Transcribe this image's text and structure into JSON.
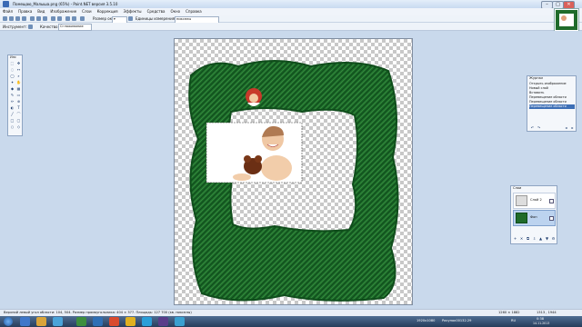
{
  "window": {
    "title": "Помещаю_Малыша.png (65%) - Paint.NET версия 3.5.10",
    "min": "–",
    "max": "□",
    "close": "✕"
  },
  "menu": [
    "Файл",
    "Правка",
    "Вид",
    "Изображение",
    "Слои",
    "Коррекция",
    "Эффекты",
    "Средства",
    "Окно",
    "Справка"
  ],
  "toolbar": {
    "size_label": "Размер окна",
    "units_label": "Единицы измерения:",
    "units_value": "пикселы",
    "instrument_label": "Инструмент:",
    "quality_label": "Качество:",
    "quality_value": "Сглаживание"
  },
  "tools_panel": {
    "title": "Инс"
  },
  "history_panel": {
    "title": "Журнал",
    "items": [
      "Открыть изображение",
      "Новый слой",
      "Вставить",
      "Перемещение области",
      "Перемещение области",
      "Перемещение области"
    ]
  },
  "layers_panel": {
    "title": "Слои",
    "layers": [
      {
        "name": "Слой 2"
      },
      {
        "name": "Фон"
      }
    ]
  },
  "status": {
    "text": "Верхний левый угол области: 104, 504. Размер прямоугольника: 404 × 377. Площадь: 127 700 (кв. пикселы)",
    "canvas_size": "1260 × 1882",
    "cursor": "1313 , 1944"
  },
  "taskbar": {
    "doc1": "1920x1080",
    "doc2": "Рисунок00132.29",
    "time": "0:38",
    "date": "14.11.2013",
    "lang": "RU"
  },
  "colors": {
    "accent": "#3a6ab5",
    "wreath": "#1f6b2a",
    "bg": "#c9d9ec"
  }
}
